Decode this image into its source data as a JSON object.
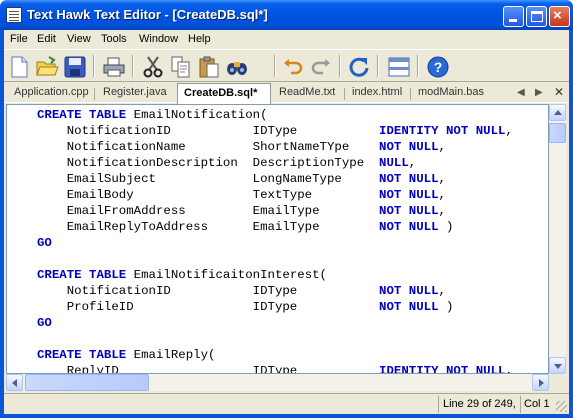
{
  "window": {
    "title": "Text Hawk Text Editor - [CreateDB.sql*]",
    "close_glyph": "×"
  },
  "menu": [
    "File",
    "Edit",
    "View",
    "Tools",
    "Window",
    "Help"
  ],
  "toolbar": {
    "buttons": [
      "new-file",
      "open-folder",
      "save",
      "print",
      "cut",
      "copy",
      "paste",
      "find",
      "undo",
      "redo",
      "refresh",
      "split-view",
      "help"
    ]
  },
  "tabs": [
    {
      "label": "Application.cpp",
      "active": false
    },
    {
      "label": "Register.java",
      "active": false
    },
    {
      "label": "CreateDB.sql*",
      "active": true
    },
    {
      "label": "ReadMe.txt",
      "active": false
    },
    {
      "label": "index.html",
      "active": false
    },
    {
      "label": "modMain.bas",
      "active": false
    }
  ],
  "tab_controls": {
    "prev": "◀",
    "next": "▶",
    "close": "✕"
  },
  "code": [
    [
      [
        "kw",
        "CREATE TABLE"
      ],
      [
        "tx",
        " EmailNotification("
      ]
    ],
    [
      [
        "tx",
        "    NotificationID           IDType           "
      ],
      [
        "kw",
        "IDENTITY NOT NULL"
      ],
      [
        "tx",
        ","
      ]
    ],
    [
      [
        "tx",
        "    NotificationName         ShortNameTYpe    "
      ],
      [
        "kw",
        "NOT NULL"
      ],
      [
        "tx",
        ","
      ]
    ],
    [
      [
        "tx",
        "    NotificationDescription  DescriptionType  "
      ],
      [
        "kw",
        "NULL"
      ],
      [
        "tx",
        ","
      ]
    ],
    [
      [
        "tx",
        "    EmailSubject             LongNameType     "
      ],
      [
        "kw",
        "NOT NULL"
      ],
      [
        "tx",
        ","
      ]
    ],
    [
      [
        "tx",
        "    EmailBody                TextType         "
      ],
      [
        "kw",
        "NOT NULL"
      ],
      [
        "tx",
        ","
      ]
    ],
    [
      [
        "tx",
        "    EmailFromAddress         EmailType        "
      ],
      [
        "kw",
        "NOT NULL"
      ],
      [
        "tx",
        ","
      ]
    ],
    [
      [
        "tx",
        "    EmailReplyToAddress      EmailType        "
      ],
      [
        "kw",
        "NOT NULL"
      ],
      [
        "tx",
        " )"
      ]
    ],
    [
      [
        "kw",
        "GO"
      ]
    ],
    [],
    [
      [
        "kw",
        "CREATE TABLE"
      ],
      [
        "tx",
        " EmailNotificaitonInterest("
      ]
    ],
    [
      [
        "tx",
        "    NotificationID           IDType           "
      ],
      [
        "kw",
        "NOT NULL"
      ],
      [
        "tx",
        ","
      ]
    ],
    [
      [
        "tx",
        "    ProfileID                IDType           "
      ],
      [
        "kw",
        "NOT NULL"
      ],
      [
        "tx",
        " )"
      ]
    ],
    [
      [
        "kw",
        "GO"
      ]
    ],
    [],
    [
      [
        "kw",
        "CREATE TABLE"
      ],
      [
        "tx",
        " EmailReply("
      ]
    ],
    [
      [
        "tx",
        "    ReplyID                  IDType           "
      ],
      [
        "kw",
        "IDENTITY NOT NULL"
      ],
      [
        "tx",
        ","
      ]
    ]
  ],
  "status": {
    "position": "Line 29 of 249,",
    "column": "Col 1"
  },
  "colors": {
    "keyword": "#0000c0",
    "title_bar": "#0054e3",
    "chrome": "#ece9d8"
  }
}
